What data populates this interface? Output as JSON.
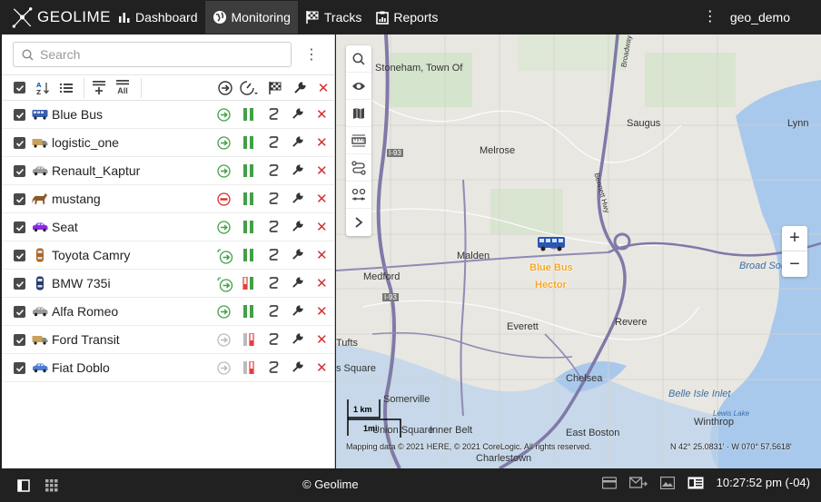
{
  "app": {
    "name": "GEOLIME",
    "user": "geo_demo",
    "copyright": "© Geolime",
    "clock": "10:27:52 pm (-04)"
  },
  "nav": [
    {
      "label": "Dashboard",
      "icon": "bar-chart-icon"
    },
    {
      "label": "Monitoring",
      "icon": "globe-icon",
      "active": true
    },
    {
      "label": "Tracks",
      "icon": "checkered-flag-icon"
    },
    {
      "label": "Reports",
      "icon": "report-icon"
    }
  ],
  "search": {
    "placeholder": "Search",
    "value": ""
  },
  "toolbar": {
    "all_label": "All"
  },
  "vehicles": [
    {
      "name": "Blue Bus",
      "icon": "bus-icon",
      "color": "#3a5fb0",
      "status": "moving",
      "signal": "full"
    },
    {
      "name": "logistic_one",
      "icon": "truck-icon",
      "color": "#c9a25a",
      "status": "moving",
      "signal": "full"
    },
    {
      "name": "Renault_Kaptur",
      "icon": "car-icon",
      "color": "#9a9a9a",
      "status": "moving",
      "signal": "full"
    },
    {
      "name": "mustang",
      "icon": "horse-icon",
      "color": "#8b5a2b",
      "status": "stopped",
      "signal": "full"
    },
    {
      "name": "Seat",
      "icon": "car-icon",
      "color": "#8a2be2",
      "status": "moving",
      "signal": "full"
    },
    {
      "name": "Toyota Camry",
      "icon": "car-top-icon",
      "color": "#b5651d",
      "status": "moving-alt",
      "signal": "full"
    },
    {
      "name": "BMW 735i",
      "icon": "car-top-icon",
      "color": "#2b3a67",
      "status": "moving-alt",
      "signal": "weak"
    },
    {
      "name": "Alfa Romeo",
      "icon": "car-icon",
      "color": "#9a9a9a",
      "status": "moving",
      "signal": "full"
    },
    {
      "name": "Ford Transit",
      "icon": "truck-icon",
      "color": "#c9a25a",
      "status": "offline",
      "signal": "weak-grey"
    },
    {
      "name": "Fiat Doblo",
      "icon": "car-icon",
      "color": "#4a7fd6",
      "status": "offline",
      "signal": "weak-grey"
    }
  ],
  "map": {
    "places": [
      "Stoneham, Town Of",
      "Melrose",
      "Saugus",
      "Lynn",
      "Malden",
      "Medford",
      "Everett",
      "Revere",
      "Tufts",
      "Chelsea",
      "Somerville",
      "East Boston",
      "Winthrop",
      "Charlestown",
      "Union Square",
      "Inner Belt"
    ],
    "partial_places": [
      "s Square"
    ],
    "water": [
      "Broad Sou",
      "Belle Isle Inlet",
      "Lewis Lake"
    ],
    "roads": [
      "I-93",
      "I-93",
      "Broadway",
      "Bennett Hwy"
    ],
    "vehicle_labels": [
      "Blue Bus",
      "Hector"
    ],
    "attribution": "Mapping data © 2021 HERE, © 2021 CoreLogic. All rights reserved.",
    "coordinates": "N 42° 25.0831' · W 070° 57.5618'",
    "scale_labels": [
      "1 km",
      "1mi"
    ]
  },
  "colors": {
    "topbar": "#212121",
    "accent_green": "#43a047",
    "delete_red": "#d32f2f",
    "vehicle_label": "#f5a623"
  }
}
